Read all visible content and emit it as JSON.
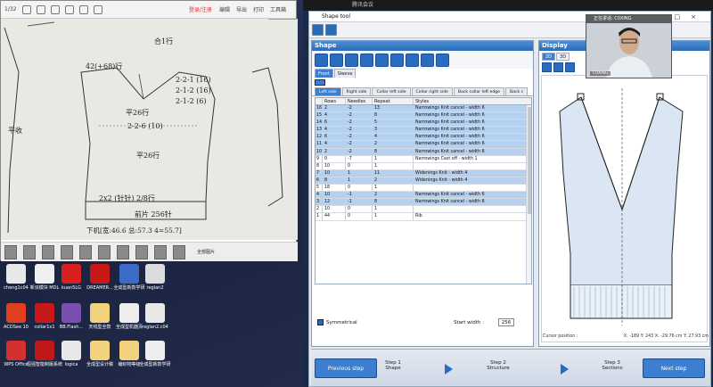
{
  "viewer": {
    "title_suffix": "1/32",
    "login": "登录/注册",
    "edit": "编辑",
    "export": "导出",
    "print": "打印",
    "toolbox": "工具箱",
    "all_pictures": "全部图片",
    "notes": {
      "n1": "合1行",
      "n2": "42(+68)行",
      "n3": "2-2-1 (16)",
      "n4": "2-1-2 (16)",
      "n5": "2-1-2 (6)",
      "n6": "平26行",
      "n7": "2-2-6 (10)",
      "n8": "平26行",
      "n9": "下机[宽:46.6 总:57.3 4=55.7]",
      "n10": "前片 256针",
      "n11": "2x2 (针针) 2/8行",
      "n12": "平收"
    }
  },
  "desktop": {
    "icons": [
      {
        "label": "cheng1c04",
        "color": "#e8e8e8"
      },
      {
        "label": "新派模块 MDL",
        "color": "#f0f0f0"
      },
      {
        "label": "kuan5LG",
        "color": "#d82020"
      },
      {
        "label": "DREAMER...",
        "color": "#c81818"
      },
      {
        "label": "全成型新款学研",
        "color": "#3a6cc8"
      },
      {
        "label": "reglan2",
        "color": "#dcdcdc"
      },
      {
        "label": "ACDSee 10",
        "color": "#e04020"
      },
      {
        "label": "collar1x1",
        "color": "#c81818"
      },
      {
        "label": "BB.Flash...",
        "color": "#7a4fb0"
      },
      {
        "label": "天线型全款",
        "color": "#f2d27a"
      },
      {
        "label": "全成型机器页",
        "color": "#eeeeee"
      },
      {
        "label": "reglan2.c04",
        "color": "#e8e8e8"
      },
      {
        "label": "WPS Office",
        "color": "#d33030"
      },
      {
        "label": "恒强智能制版系统",
        "color": "#c01818"
      },
      {
        "label": "logica",
        "color": "#e8e8e8"
      },
      {
        "label": "全成型设计稿",
        "color": "#f2d27a"
      },
      {
        "label": "编织物等级",
        "color": "#f2d27a"
      },
      {
        "label": "全成型新款学研",
        "color": "#eeeeee"
      }
    ]
  },
  "meeting_bar": "腾讯会议",
  "shape_tool": {
    "title": "Shape tool",
    "panel_title": "Shape",
    "view_tabs": [
      "Front",
      "Sleeve"
    ],
    "section_tabs": [
      "Left side",
      "Right side",
      "Collar left side",
      "Collar right side",
      "Back collar left edge",
      "Back c"
    ],
    "columns": [
      "Rows",
      "Needles",
      "Repeat",
      "Styles"
    ],
    "rows": [
      {
        "idx": "16",
        "rows": "2",
        "needles": "-2",
        "repeat": "13",
        "style": "Narrowings Knit cancel - width 6",
        "hl": true
      },
      {
        "idx": "15",
        "rows": "4",
        "needles": "-2",
        "repeat": "8",
        "style": "Narrowings Knit cancel - width 6",
        "hl": true
      },
      {
        "idx": "14",
        "rows": "6",
        "needles": "-2",
        "repeat": "5",
        "style": "Narrowings Knit cancel - width 6",
        "hl": true
      },
      {
        "idx": "13",
        "rows": "4",
        "needles": "-2",
        "repeat": "3",
        "style": "Narrowings Knit cancel - width 6",
        "hl": true
      },
      {
        "idx": "12",
        "rows": "6",
        "needles": "-2",
        "repeat": "4",
        "style": "Narrowings Knit cancel - width 6",
        "hl": true
      },
      {
        "idx": "11",
        "rows": "4",
        "needles": "-2",
        "repeat": "2",
        "style": "Narrowings Knit cancel - width 6",
        "hl": true
      },
      {
        "idx": "10",
        "rows": "2",
        "needles": "-2",
        "repeat": "8",
        "style": "Narrowings Knit cancel - width 6",
        "hl": true
      },
      {
        "idx": "9",
        "rows": "0",
        "needles": "-7",
        "repeat": "1",
        "style": "Narrowings Cast off - width 1",
        "hl": false
      },
      {
        "idx": "8",
        "rows": "10",
        "needles": "0",
        "repeat": "1",
        "style": "",
        "hl": false
      },
      {
        "idx": "7",
        "rows": "10",
        "needles": "1",
        "repeat": "11",
        "style": "Widenings Knit - width 4",
        "hl": true
      },
      {
        "idx": "6",
        "rows": "8",
        "needles": "1",
        "repeat": "2",
        "style": "Widenings Knit - width 4",
        "hl": true
      },
      {
        "idx": "5",
        "rows": "18",
        "needles": "0",
        "repeat": "1",
        "style": "",
        "hl": false
      },
      {
        "idx": "4",
        "rows": "10",
        "needles": "-1",
        "repeat": "2",
        "style": "Narrowings Knit cancel - width 6",
        "hl": true
      },
      {
        "idx": "3",
        "rows": "12",
        "needles": "-1",
        "repeat": "8",
        "style": "Narrowings Knit cancel - width 6",
        "hl": true
      },
      {
        "idx": "2",
        "rows": "10",
        "needles": "0",
        "repeat": "1",
        "style": "",
        "hl": false
      },
      {
        "idx": "1",
        "rows": "44",
        "needles": "0",
        "repeat": "1",
        "style": "Rib",
        "hl": false
      }
    ],
    "symmetrical_label": "Symmetrical",
    "start_width_label": "Start width :",
    "start_width_value": "256"
  },
  "display": {
    "title": "Display",
    "tabs": [
      "2D",
      "3D"
    ],
    "cursor_label": "Cursor position :",
    "cursor_values": "X: -189  Y: 243  X: -29.76 cm  Y: 27.93 cm"
  },
  "wizard": {
    "prev": "Previous step",
    "next": "Next step",
    "steps": [
      {
        "name": "Step 1",
        "label": "Shape"
      },
      {
        "name": "Step 2",
        "label": "Structure"
      },
      {
        "name": "Step 3",
        "label": "Sections"
      }
    ]
  },
  "webcam": {
    "label": "正在讲话: C0XING",
    "name": "C0XING"
  }
}
